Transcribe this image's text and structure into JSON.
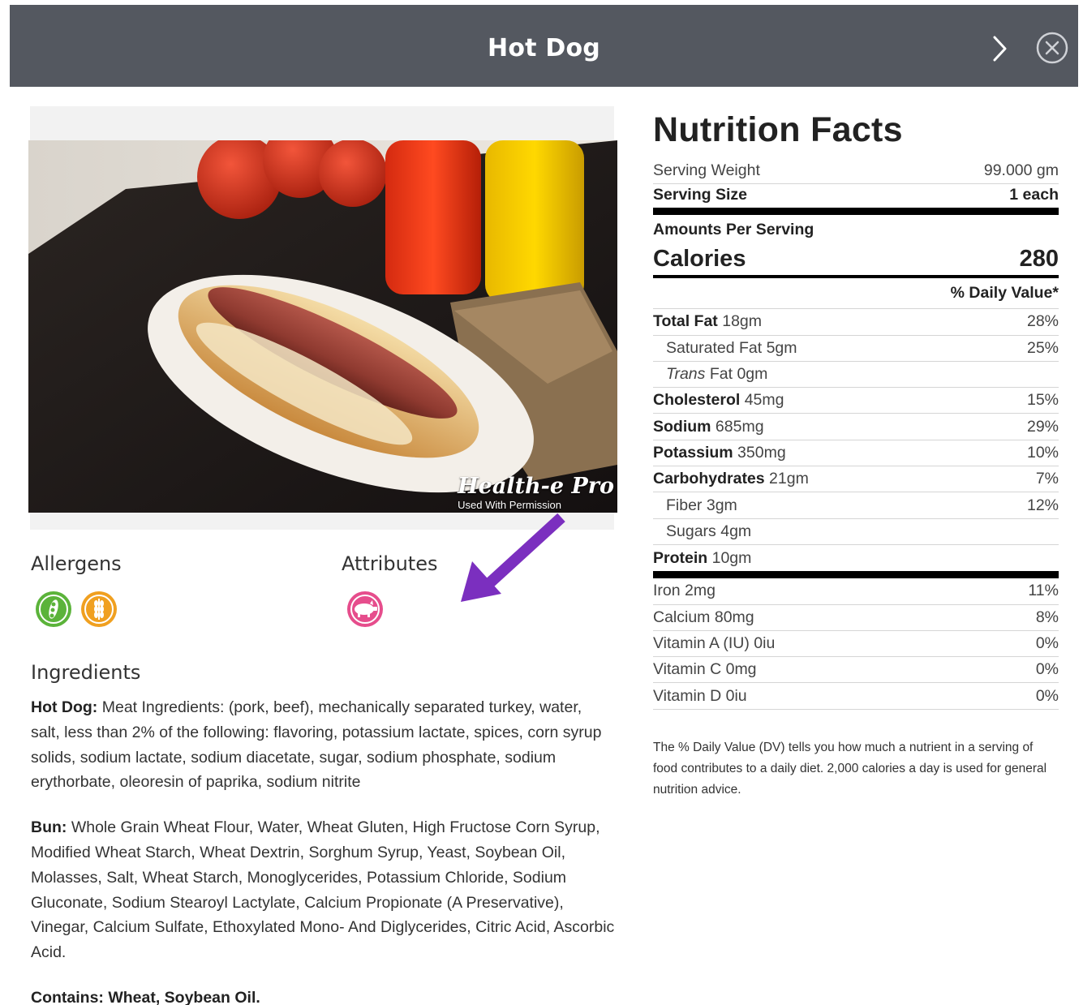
{
  "header": {
    "title": "Hot Dog"
  },
  "photo": {
    "watermark_brand": "Health-e Pro",
    "watermark_sub": "Used With Permission"
  },
  "allergens": {
    "title": "Allergens",
    "icons": [
      "soy-icon",
      "wheat-icon"
    ]
  },
  "attributes": {
    "title": "Attributes",
    "icons": [
      "pork-icon"
    ]
  },
  "ingredients": {
    "title": "Ingredients",
    "hotdog_label": "Hot Dog:",
    "hotdog_text": " Meat Ingredients: (pork, beef), mechanically separated turkey, water, salt, less than 2% of the following: flavoring, potassium lactate, spices, corn syrup solids, sodium lactate, sodium diacetate, sugar, sodium phosphate, sodium erythorbate, oleoresin of paprika, sodium nitrite",
    "bun_label": "Bun:",
    "bun_text": " Whole Grain Wheat Flour, Water, Wheat Gluten, High Fructose Corn Syrup, Modified Wheat Starch, Wheat Dextrin, Sorghum Syrup, Yeast, Soybean Oil, Molasses, Salt, Wheat Starch, Monoglycerides, Potassium Chloride, Sodium Gluconate, Sodium Stearoyl Lactylate, Calcium Propionate (A Preservative), Vinegar, Calcium Sulfate, Ethoxylated Mono- And Diglycerides, Citric Acid, Ascorbic Acid.",
    "contains": "Contains: Wheat, Soybean Oil."
  },
  "nutrition": {
    "title": "Nutrition Facts",
    "serving_weight_label": "Serving Weight",
    "serving_weight_value": "99.000 gm",
    "serving_size_label": "Serving Size",
    "serving_size_value": "1 each",
    "amounts_label": "Amounts Per Serving",
    "calories_label": "Calories",
    "calories_value": "280",
    "dv_header": "% Daily Value*",
    "total_fat": {
      "label": "Total Fat",
      "amount": "18gm",
      "dv": "28%"
    },
    "saturated_fat": {
      "label": "Saturated Fat",
      "amount": "5gm",
      "dv": "25%"
    },
    "trans_fat": {
      "label_italic": "Trans",
      "label": "Fat",
      "amount": "0gm"
    },
    "cholesterol": {
      "label": "Cholesterol",
      "amount": "45mg",
      "dv": "15%"
    },
    "sodium": {
      "label": "Sodium",
      "amount": "685mg",
      "dv": "29%"
    },
    "potassium": {
      "label": "Potassium",
      "amount": "350mg",
      "dv": "10%"
    },
    "carbohydrates": {
      "label": "Carbohydrates",
      "amount": "21gm",
      "dv": "7%"
    },
    "fiber": {
      "label": "Fiber",
      "amount": "3gm",
      "dv": "12%"
    },
    "sugars": {
      "label": "Sugars",
      "amount": "4gm"
    },
    "protein": {
      "label": "Protein",
      "amount": "10gm"
    },
    "iron": {
      "label": "Iron",
      "amount": "2mg",
      "dv": "11%"
    },
    "calcium": {
      "label": "Calcium",
      "amount": "80mg",
      "dv": "8%"
    },
    "vitamin_a": {
      "label": "Vitamin A (IU)",
      "amount": "0iu",
      "dv": "0%"
    },
    "vitamin_c": {
      "label": "Vitamin C",
      "amount": "0mg",
      "dv": "0%"
    },
    "vitamin_d": {
      "label": "Vitamin D",
      "amount": "0iu",
      "dv": "0%"
    },
    "footnote": "The % Daily Value (DV) tells you how much a nutrient in a serving of food contributes to a daily diet. 2,000 calories a day is used for general nutrition advice."
  },
  "colors": {
    "header_bg": "#545860",
    "arrow": "#7b2fbf",
    "soy_green": "#5bb33a",
    "wheat_orange": "#f0a020",
    "pork_pink": "#e64d8c"
  }
}
